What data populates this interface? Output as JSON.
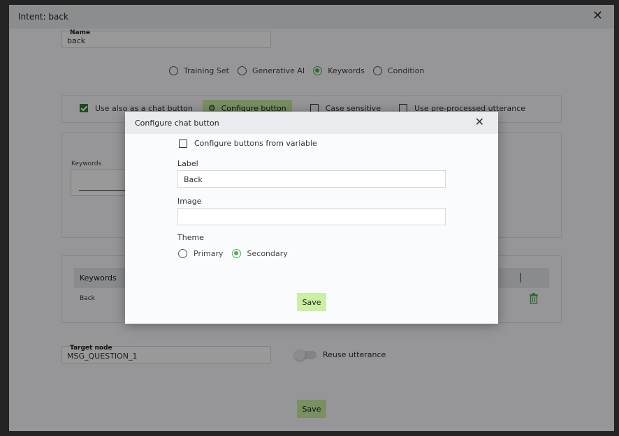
{
  "intent_window": {
    "title": "Intent: back",
    "close_glyph": "✕",
    "name_field": {
      "label": "Name",
      "value": "back"
    },
    "intent_type": {
      "options": [
        "Training Set",
        "Generative AI",
        "Keywords",
        "Condition"
      ],
      "selected": "Keywords"
    },
    "chat_options": {
      "use_as_chat_button": {
        "label": "Use also as a chat button",
        "checked": true
      },
      "configure_button_label": "Configure button",
      "case_sensitive": {
        "label": "Case sensitive",
        "checked": false
      },
      "pre_processed": {
        "label": "Use pre-processed utterance",
        "checked": false
      }
    },
    "keywords_input_label": "Keywords",
    "keywords_table": {
      "header": "Keywords",
      "rows": [
        "Back"
      ]
    },
    "target_node": {
      "label": "Target node",
      "value": "MSG_QUESTION_1"
    },
    "reuse_utterance": {
      "label": "Reuse utterance",
      "on": false
    },
    "save_label": "Save"
  },
  "modal": {
    "title": "Configure chat button",
    "close_glyph": "✕",
    "from_variable": {
      "label": "Configure buttons from variable",
      "checked": false
    },
    "label_field": {
      "label": "Label",
      "value": "Back"
    },
    "image_field": {
      "label": "Image",
      "value": ""
    },
    "theme": {
      "label": "Theme",
      "options": [
        "Primary",
        "Secondary"
      ],
      "selected": "Secondary"
    },
    "save_label": "Save"
  },
  "colors": {
    "accent_green": "#4caf50",
    "button_green": "#c9f0a4",
    "checkbox_green": "#2e7d32"
  }
}
